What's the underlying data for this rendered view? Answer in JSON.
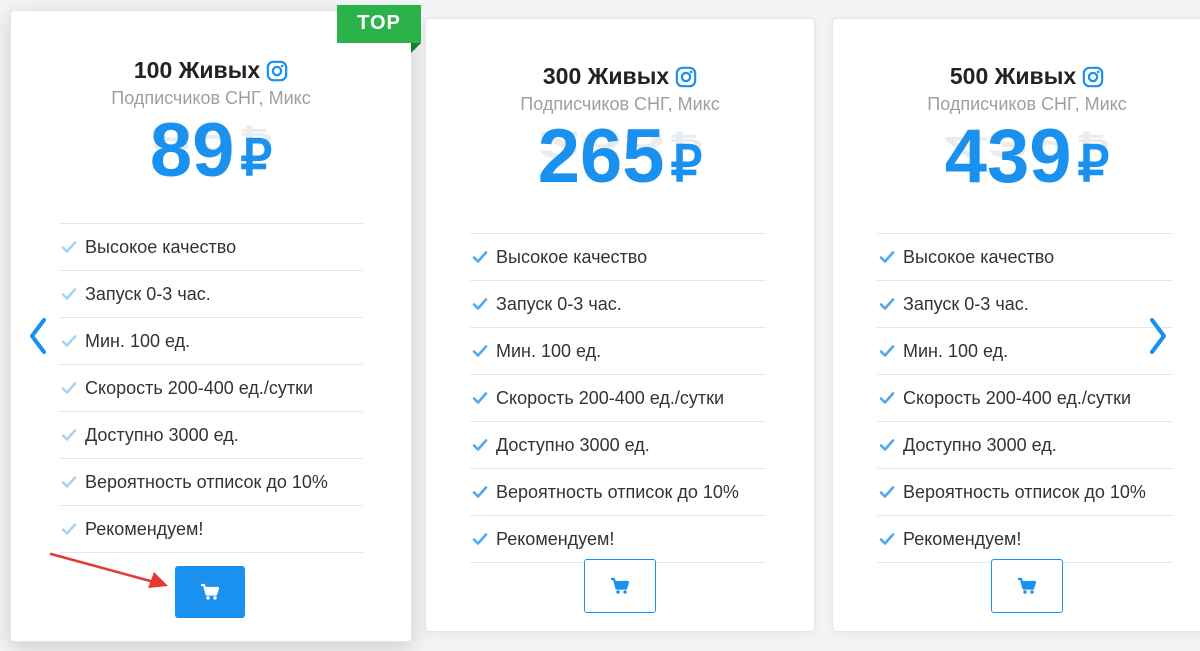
{
  "colors": {
    "accent": "#1a90ef",
    "badge": "#2bb34a",
    "check": "#52a8ec",
    "red_arrow": "#e53935"
  },
  "icons": {
    "instagram": "instagram-icon",
    "check": "check-icon",
    "cart": "shopping-cart-icon",
    "prev": "chevron-left-icon",
    "next": "chevron-right-icon"
  },
  "cards": [
    {
      "badge": "TOP",
      "title": "100 Живых",
      "subtitle": "Подписчиков СНГ, Микс",
      "price": "89",
      "currency": "₽",
      "features": [
        "Высокое качество",
        "Запуск 0-3 час.",
        "Мин. 100 ед.",
        "Скорость 200-400 ед./сутки",
        "Доступно 3000 ед.",
        "Вероятность отписок до 10%",
        "Рекомендуем!"
      ]
    },
    {
      "title": "300 Живых",
      "subtitle": "Подписчиков СНГ, Микс",
      "price": "265",
      "currency": "₽",
      "features": [
        "Высокое качество",
        "Запуск 0-3 час.",
        "Мин. 100 ед.",
        "Скорость 200-400 ед./сутки",
        "Доступно 3000 ед.",
        "Вероятность отписок до 10%",
        "Рекомендуем!"
      ]
    },
    {
      "title": "500 Живых",
      "subtitle": "Подписчиков СНГ, Микс",
      "price": "439",
      "currency": "₽",
      "features": [
        "Высокое качество",
        "Запуск 0-3 час.",
        "Мин. 100 ед.",
        "Скорость 200-400 ед./сутки",
        "Доступно 3000 ед.",
        "Вероятность отписок до 10%",
        "Рекомендуем!"
      ]
    }
  ]
}
